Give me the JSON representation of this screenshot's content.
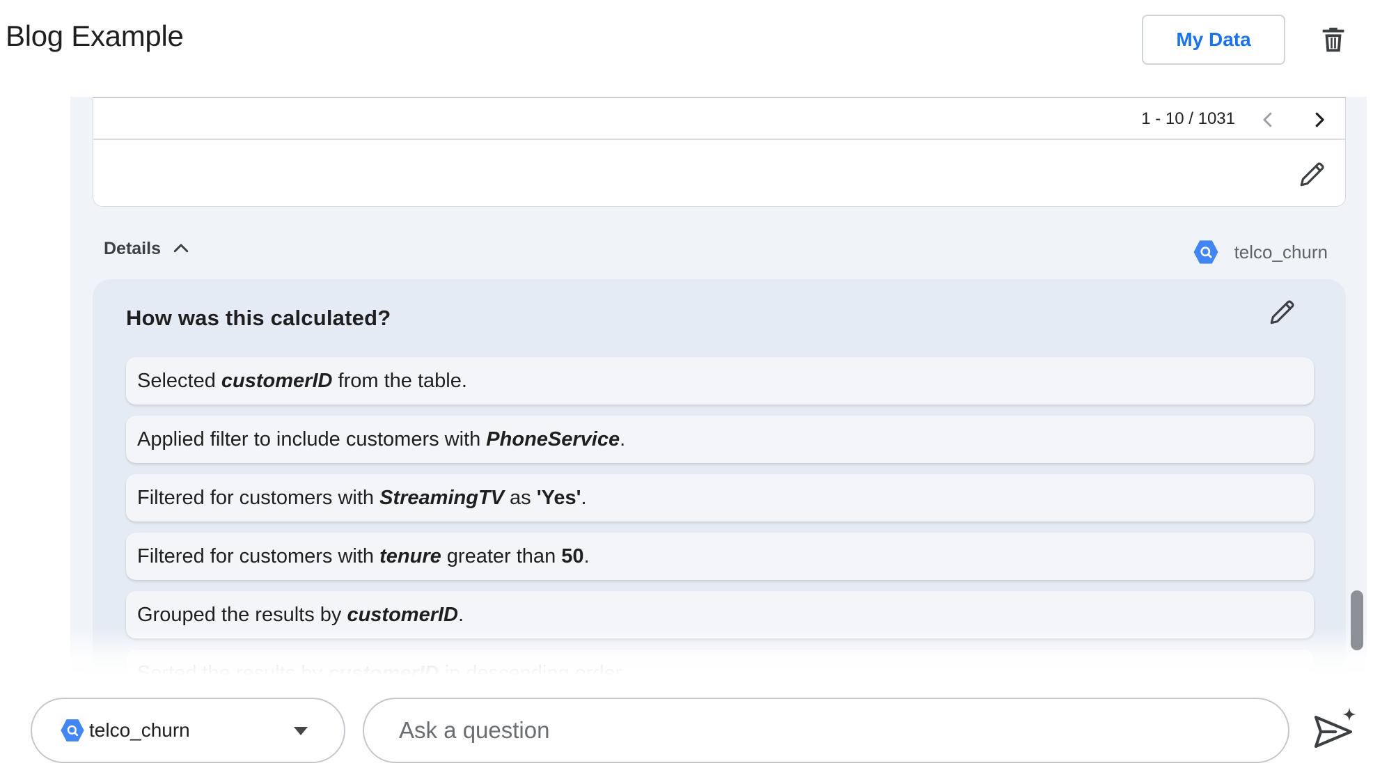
{
  "header": {
    "title": "Blog Example",
    "my_data_label": "My Data"
  },
  "results": {
    "pagination": "1 - 10 / 1031"
  },
  "details": {
    "toggle_label": "Details",
    "dataset_name": "telco_churn",
    "title": "How was this calculated?",
    "steps": [
      [
        {
          "t": "Selected "
        },
        {
          "t": "customerID",
          "s": "bi"
        },
        {
          "t": " from the table."
        }
      ],
      [
        {
          "t": "Applied filter to include customers with "
        },
        {
          "t": "PhoneService",
          "s": "bi"
        },
        {
          "t": "."
        }
      ],
      [
        {
          "t": "Filtered for customers with "
        },
        {
          "t": "StreamingTV",
          "s": "bi"
        },
        {
          "t": " as "
        },
        {
          "t": "'Yes'",
          "s": "b"
        },
        {
          "t": "."
        }
      ],
      [
        {
          "t": "Filtered for customers with "
        },
        {
          "t": "tenure",
          "s": "bi"
        },
        {
          "t": " greater than "
        },
        {
          "t": "50",
          "s": "b"
        },
        {
          "t": "."
        }
      ],
      [
        {
          "t": "Grouped the results by "
        },
        {
          "t": "customerID",
          "s": "bi"
        },
        {
          "t": "."
        }
      ],
      [
        {
          "t": "Sorted the results by "
        },
        {
          "t": "customerID",
          "s": "bi"
        },
        {
          "t": " in descending order."
        }
      ]
    ]
  },
  "input_bar": {
    "dataset_value": "telco_churn",
    "question_placeholder": "Ask a question"
  },
  "icons": {
    "trash": "trash-icon",
    "pager_prev": "chevron-left-icon",
    "pager_next": "chevron-right-icon",
    "edit": "pencil-icon",
    "toggle": "chevron-up-icon",
    "dataset": "bigquery-hexagon-icon",
    "dropdown": "caret-down-icon",
    "send": "send-sparkle-icon"
  },
  "colors": {
    "accent": "#1a73e8",
    "panel_bg": "#f0f4f9",
    "calc_bg": "#e5ebf4",
    "dataset_icon": "#4285f4"
  }
}
